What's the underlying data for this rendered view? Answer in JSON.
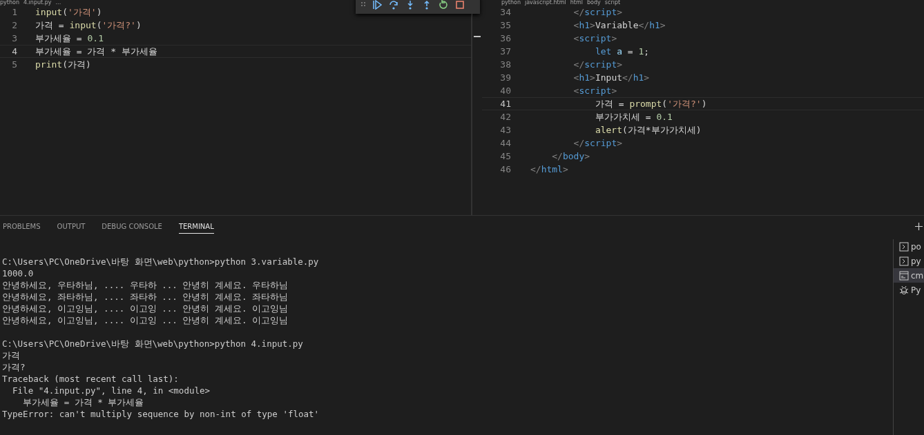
{
  "left_editor": {
    "breadcrumbs": [
      "python",
      "4.input.py",
      "..."
    ],
    "lines": [
      {
        "number": "1",
        "current": false,
        "tokens": [
          {
            "kind": "func",
            "text": "input"
          },
          {
            "kind": "plain",
            "text": "("
          },
          {
            "kind": "string",
            "text": "'가격'"
          },
          {
            "kind": "plain",
            "text": ")"
          }
        ]
      },
      {
        "number": "2",
        "current": false,
        "tokens": [
          {
            "kind": "plain",
            "text": "가격 = "
          },
          {
            "kind": "func",
            "text": "input"
          },
          {
            "kind": "plain",
            "text": "("
          },
          {
            "kind": "string",
            "text": "'가격?'"
          },
          {
            "kind": "plain",
            "text": ")"
          }
        ]
      },
      {
        "number": "3",
        "current": false,
        "tokens": [
          {
            "kind": "plain",
            "text": "부가세율 = "
          },
          {
            "kind": "number",
            "text": "0.1"
          }
        ]
      },
      {
        "number": "4",
        "current": true,
        "tokens": [
          {
            "kind": "plain",
            "text": "부가세율 = 가격 * 부가세율"
          }
        ]
      },
      {
        "number": "5",
        "current": false,
        "tokens": [
          {
            "kind": "func",
            "text": "print"
          },
          {
            "kind": "plain",
            "text": "(가격)"
          }
        ]
      }
    ]
  },
  "right_editor": {
    "breadcrumbs": [
      "python",
      "javascript.html",
      "html",
      "body",
      "script"
    ],
    "lines": [
      {
        "number": "34",
        "current": false,
        "tokens": [
          {
            "kind": "bracket",
            "text": "        </"
          },
          {
            "kind": "tag",
            "text": "script"
          },
          {
            "kind": "bracket",
            "text": ">"
          }
        ]
      },
      {
        "number": "35",
        "current": false,
        "tokens": [
          {
            "kind": "bracket",
            "text": "        <"
          },
          {
            "kind": "tag",
            "text": "h1"
          },
          {
            "kind": "bracket",
            "text": ">"
          },
          {
            "kind": "plain",
            "text": "Variable"
          },
          {
            "kind": "bracket",
            "text": "</"
          },
          {
            "kind": "tag",
            "text": "h1"
          },
          {
            "kind": "bracket",
            "text": ">"
          }
        ]
      },
      {
        "number": "36",
        "current": false,
        "tokens": [
          {
            "kind": "bracket",
            "text": "        <"
          },
          {
            "kind": "tag",
            "text": "script"
          },
          {
            "kind": "bracket",
            "text": ">"
          }
        ]
      },
      {
        "number": "37",
        "current": false,
        "tokens": [
          {
            "kind": "keyword",
            "text": "            let "
          },
          {
            "kind": "variable",
            "text": "a"
          },
          {
            "kind": "plain",
            "text": " = "
          },
          {
            "kind": "number",
            "text": "1"
          },
          {
            "kind": "plain",
            "text": ";"
          }
        ]
      },
      {
        "number": "38",
        "current": false,
        "tokens": [
          {
            "kind": "bracket",
            "text": "        </"
          },
          {
            "kind": "tag",
            "text": "script"
          },
          {
            "kind": "bracket",
            "text": ">"
          }
        ]
      },
      {
        "number": "39",
        "current": false,
        "tokens": [
          {
            "kind": "bracket",
            "text": "        <"
          },
          {
            "kind": "tag",
            "text": "h1"
          },
          {
            "kind": "bracket",
            "text": ">"
          },
          {
            "kind": "plain",
            "text": "Input"
          },
          {
            "kind": "bracket",
            "text": "</"
          },
          {
            "kind": "tag",
            "text": "h1"
          },
          {
            "kind": "bracket",
            "text": ">"
          }
        ]
      },
      {
        "number": "40",
        "current": false,
        "tokens": [
          {
            "kind": "bracket",
            "text": "        <"
          },
          {
            "kind": "tag",
            "text": "script"
          },
          {
            "kind": "bracket",
            "text": ">"
          }
        ]
      },
      {
        "number": "41",
        "current": true,
        "tokens": [
          {
            "kind": "plain",
            "text": "            가격 = "
          },
          {
            "kind": "func",
            "text": "prompt"
          },
          {
            "kind": "plain",
            "text": "("
          },
          {
            "kind": "string",
            "text": "'가격?'"
          },
          {
            "kind": "plain",
            "text": ")"
          }
        ]
      },
      {
        "number": "42",
        "current": false,
        "tokens": [
          {
            "kind": "plain",
            "text": "            부가가치세 = "
          },
          {
            "kind": "number",
            "text": "0.1"
          }
        ]
      },
      {
        "number": "43",
        "current": false,
        "tokens": [
          {
            "kind": "func",
            "text": "            alert"
          },
          {
            "kind": "plain",
            "text": "(가격*부가가치세)"
          }
        ]
      },
      {
        "number": "44",
        "current": false,
        "tokens": [
          {
            "kind": "bracket",
            "text": "        </"
          },
          {
            "kind": "tag",
            "text": "script"
          },
          {
            "kind": "bracket",
            "text": ">"
          }
        ]
      },
      {
        "number": "45",
        "current": false,
        "tokens": [
          {
            "kind": "bracket",
            "text": "    </"
          },
          {
            "kind": "tag",
            "text": "body"
          },
          {
            "kind": "bracket",
            "text": ">"
          }
        ]
      },
      {
        "number": "46",
        "current": false,
        "tokens": [
          {
            "kind": "bracket",
            "text": "</"
          },
          {
            "kind": "tag",
            "text": "html"
          },
          {
            "kind": "bracket",
            "text": ">"
          }
        ]
      }
    ]
  },
  "panel": {
    "tabs": [
      {
        "label": "PROBLEMS",
        "selected": false
      },
      {
        "label": "OUTPUT",
        "selected": false
      },
      {
        "label": "DEBUG CONSOLE",
        "selected": false
      },
      {
        "label": "TERMINAL",
        "selected": true
      }
    ],
    "terminal_blocks": [
      [
        "C:\\Users\\PC\\OneDrive\\바탕 화면\\web\\python>python 3.variable.py",
        "1000.0",
        "안녕하세요, 우타하님, .... 우타하 ... 안녕히 계세요. 우타하님",
        "안녕하세요, 좌타하님, .... 좌타하 ... 안녕히 계세요. 좌타하님",
        "안녕하세요, 이고잉님, .... 이고잉 ... 안녕히 계세요. 이고잉님",
        "안녕하세요, 이고잉님, .... 이고잉 ... 안녕히 계세요. 이고잉님"
      ],
      [
        "C:\\Users\\PC\\OneDrive\\바탕 화면\\web\\python>python 4.input.py",
        "가격",
        "가격?",
        "Traceback (most recent call last):",
        "  File \"4.input.py\", line 4, in <module>",
        "    부가세율 = 가격 * 부가세율",
        "TypeError: can't multiply sequence by non-int of type 'float'"
      ]
    ],
    "sessions": [
      {
        "kind": "shell",
        "label": "po",
        "selected": false
      },
      {
        "kind": "shell",
        "label": "py",
        "selected": false
      },
      {
        "kind": "cmd",
        "label": "cm",
        "selected": true
      },
      {
        "kind": "debug",
        "label": "Py",
        "selected": false
      }
    ]
  }
}
